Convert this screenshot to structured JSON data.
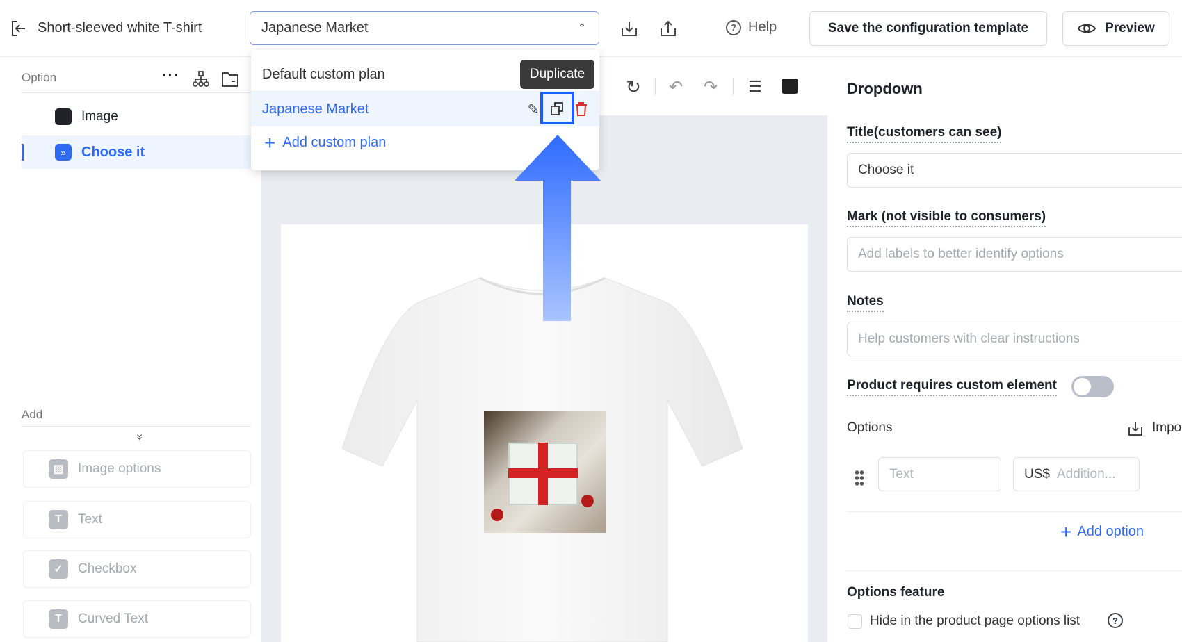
{
  "header": {
    "title": "Short-sleeved white T-shirt",
    "plan_selected": "Japanese Market",
    "help": "Help",
    "save_template": "Save the configuration template",
    "preview": "Preview"
  },
  "plan_menu": {
    "items": [
      {
        "label": "Default custom plan"
      },
      {
        "label": "Japanese Market"
      }
    ],
    "add_label": "Add custom plan",
    "tooltip": "Duplicate"
  },
  "left": {
    "option_label": "Option",
    "layers": [
      {
        "label": "Image"
      },
      {
        "label": "Choose it"
      }
    ],
    "add_label": "Add",
    "add_items": [
      {
        "label": "Image options"
      },
      {
        "label": "Text"
      },
      {
        "label": "Checkbox"
      },
      {
        "label": "Curved Text"
      }
    ]
  },
  "right": {
    "heading": "Dropdown",
    "title_label": "Title(customers can see)",
    "title_value": "Choose it",
    "mark_label": "Mark (not visible to consumers)",
    "mark_placeholder": "Add labels to better identify options",
    "notes_label": "Notes",
    "notes_placeholder": "Help customers with clear instructions",
    "requires_label": "Product requires custom element",
    "requires_on": false,
    "options_label": "Options",
    "import_label": "Impo",
    "option_text_placeholder": "Text",
    "currency": "US$",
    "addition_placeholder": "Addition...",
    "add_option": "Add option",
    "feature_label": "Options feature",
    "hide_label": "Hide in the product page options list",
    "hide_checked": false
  },
  "colors": {
    "accent": "#2f6bf0",
    "highlight": "#1f5cff"
  }
}
